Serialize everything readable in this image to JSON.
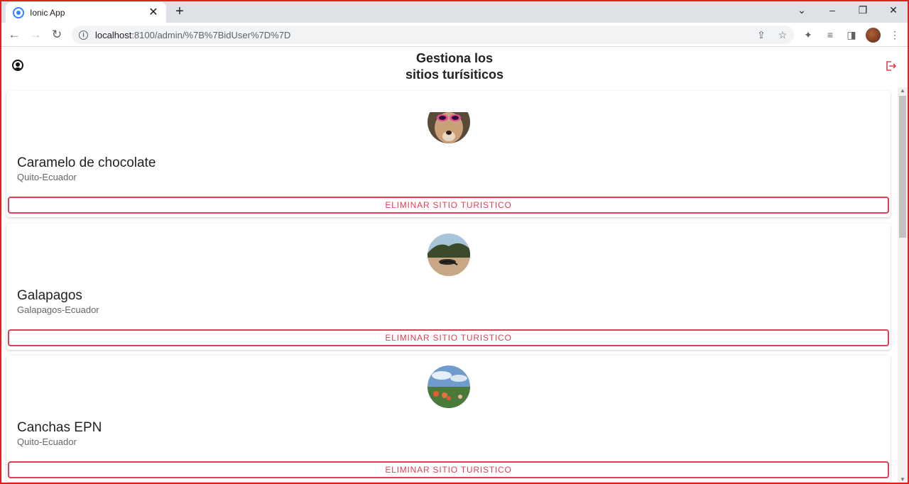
{
  "browser": {
    "tab_title": "Ionic App",
    "url_host": "localhost",
    "url_path": ":8100/admin/%7B%7BidUser%7D%7D"
  },
  "header": {
    "title_line1": "Gestiona los",
    "title_line2": "sitios turísiticos"
  },
  "places": [
    {
      "name": "Caramelo de chocolate",
      "location": "Quito-Ecuador",
      "image_icon": "dog-photo"
    },
    {
      "name": "Galapagos",
      "location": "Galapagos-Ecuador",
      "image_icon": "iguana-beach-photo"
    },
    {
      "name": "Canchas EPN",
      "location": "Quito-Ecuador",
      "image_icon": "flowers-sky-photo"
    }
  ],
  "delete_label": "ELIMINAR SITIO TURISTICO",
  "colors": {
    "accent": "#e04055",
    "ionic_blue": "#3880ff"
  }
}
